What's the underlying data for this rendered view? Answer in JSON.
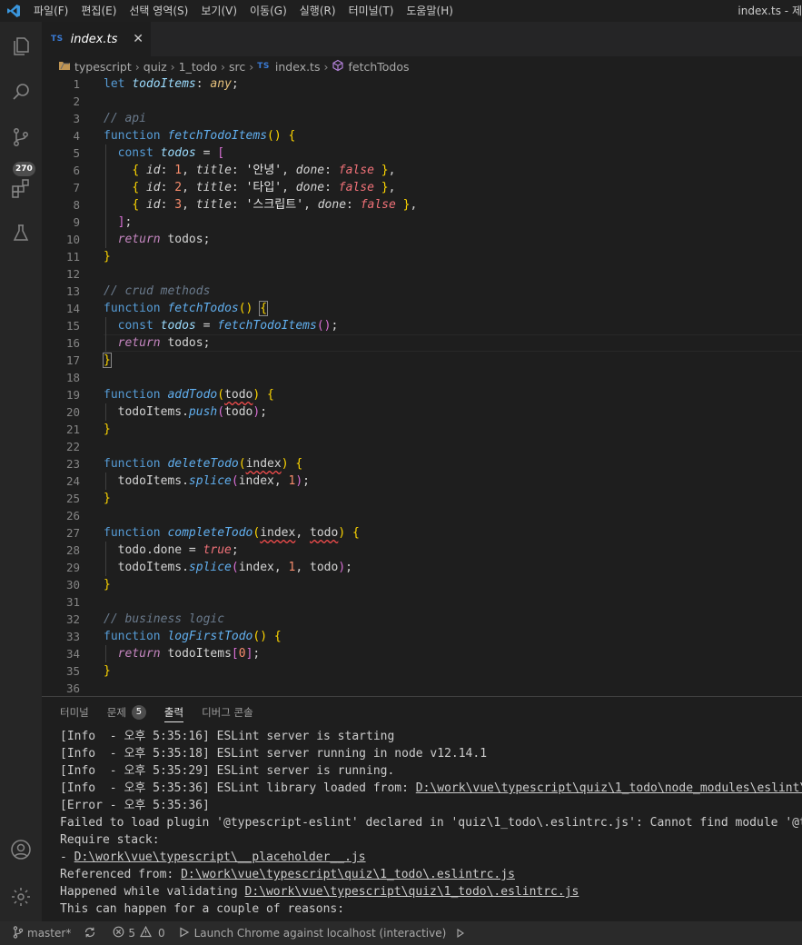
{
  "menu": [
    "파일(F)",
    "편집(E)",
    "선택 영역(S)",
    "보기(V)",
    "이동(G)",
    "실행(R)",
    "터미널(T)",
    "도움말(H)"
  ],
  "window_title": "index.ts - 제",
  "activity": {
    "scm_badge": "270"
  },
  "tab": {
    "badge": "TS",
    "label": "index.ts",
    "close": "✕"
  },
  "breadcrumb": {
    "items": [
      "typescript",
      "quiz",
      "1_todo",
      "src",
      "index.ts",
      "fetchTodos"
    ],
    "ts_badge": "TS"
  },
  "editor": {
    "current_line": 16,
    "lines": [
      {
        "n": "1",
        "t": [
          [
            "kw",
            "let"
          ],
          [
            "id",
            " "
          ],
          [
            "var",
            "todoItems"
          ],
          [
            "op",
            ":"
          ],
          [
            "id",
            " "
          ],
          [
            "type",
            "any"
          ],
          [
            "op",
            ";"
          ]
        ]
      },
      {
        "n": "2",
        "t": []
      },
      {
        "n": "3",
        "t": [
          [
            "cmt",
            "// api"
          ]
        ]
      },
      {
        "n": "4",
        "t": [
          [
            "kw",
            "function"
          ],
          [
            "id",
            " "
          ],
          [
            "fn",
            "fetchTodoItems"
          ],
          [
            "br1",
            "()"
          ],
          [
            "id",
            " "
          ],
          [
            "br1",
            "{"
          ]
        ]
      },
      {
        "n": "5",
        "t": [
          [
            "id",
            "  "
          ],
          [
            "kw",
            "const"
          ],
          [
            "id",
            " "
          ],
          [
            "var",
            "todos"
          ],
          [
            "id",
            " "
          ],
          [
            "op",
            "="
          ],
          [
            "id",
            " "
          ],
          [
            "br2",
            "["
          ]
        ]
      },
      {
        "n": "6",
        "t": [
          [
            "id",
            "    "
          ],
          [
            "br1",
            "{"
          ],
          [
            "id",
            " "
          ],
          [
            "prop",
            "id"
          ],
          [
            "op",
            ":"
          ],
          [
            "id",
            " "
          ],
          [
            "num",
            "1"
          ],
          [
            "op",
            ","
          ],
          [
            "id",
            " "
          ],
          [
            "prop",
            "title"
          ],
          [
            "op",
            ":"
          ],
          [
            "id",
            " "
          ],
          [
            "str",
            "'안녕'"
          ],
          [
            "op",
            ","
          ],
          [
            "id",
            " "
          ],
          [
            "prop",
            "done"
          ],
          [
            "op",
            ":"
          ],
          [
            "id",
            " "
          ],
          [
            "bool",
            "false"
          ],
          [
            "id",
            " "
          ],
          [
            "br1",
            "}"
          ],
          [
            "op",
            ","
          ]
        ]
      },
      {
        "n": "7",
        "t": [
          [
            "id",
            "    "
          ],
          [
            "br1",
            "{"
          ],
          [
            "id",
            " "
          ],
          [
            "prop",
            "id"
          ],
          [
            "op",
            ":"
          ],
          [
            "id",
            " "
          ],
          [
            "num",
            "2"
          ],
          [
            "op",
            ","
          ],
          [
            "id",
            " "
          ],
          [
            "prop",
            "title"
          ],
          [
            "op",
            ":"
          ],
          [
            "id",
            " "
          ],
          [
            "str",
            "'타입'"
          ],
          [
            "op",
            ","
          ],
          [
            "id",
            " "
          ],
          [
            "prop",
            "done"
          ],
          [
            "op",
            ":"
          ],
          [
            "id",
            " "
          ],
          [
            "bool",
            "false"
          ],
          [
            "id",
            " "
          ],
          [
            "br1",
            "}"
          ],
          [
            "op",
            ","
          ]
        ]
      },
      {
        "n": "8",
        "t": [
          [
            "id",
            "    "
          ],
          [
            "br1",
            "{"
          ],
          [
            "id",
            " "
          ],
          [
            "prop",
            "id"
          ],
          [
            "op",
            ":"
          ],
          [
            "id",
            " "
          ],
          [
            "num",
            "3"
          ],
          [
            "op",
            ","
          ],
          [
            "id",
            " "
          ],
          [
            "prop",
            "title"
          ],
          [
            "op",
            ":"
          ],
          [
            "id",
            " "
          ],
          [
            "str",
            "'스크립트'"
          ],
          [
            "op",
            ","
          ],
          [
            "id",
            " "
          ],
          [
            "prop",
            "done"
          ],
          [
            "op",
            ":"
          ],
          [
            "id",
            " "
          ],
          [
            "bool",
            "false"
          ],
          [
            "id",
            " "
          ],
          [
            "br1",
            "}"
          ],
          [
            "op",
            ","
          ]
        ]
      },
      {
        "n": "9",
        "t": [
          [
            "id",
            "  "
          ],
          [
            "br2",
            "]"
          ],
          [
            "op",
            ";"
          ]
        ]
      },
      {
        "n": "10",
        "t": [
          [
            "id",
            "  "
          ],
          [
            "ctl",
            "return"
          ],
          [
            "id",
            " todos;"
          ]
        ]
      },
      {
        "n": "11",
        "t": [
          [
            "br1",
            "}"
          ]
        ]
      },
      {
        "n": "12",
        "t": []
      },
      {
        "n": "13",
        "t": [
          [
            "cmt",
            "// crud methods"
          ]
        ]
      },
      {
        "n": "14",
        "t": [
          [
            "kw",
            "function"
          ],
          [
            "id",
            " "
          ],
          [
            "fn",
            "fetchTodos"
          ],
          [
            "br1",
            "()"
          ],
          [
            "id",
            " "
          ],
          [
            "br1m",
            "{"
          ]
        ]
      },
      {
        "n": "15",
        "t": [
          [
            "id",
            "  "
          ],
          [
            "kw",
            "const"
          ],
          [
            "id",
            " "
          ],
          [
            "var",
            "todos"
          ],
          [
            "id",
            " "
          ],
          [
            "op",
            "="
          ],
          [
            "id",
            " "
          ],
          [
            "fn",
            "fetchTodoItems"
          ],
          [
            "br2",
            "()"
          ],
          [
            "op",
            ";"
          ]
        ]
      },
      {
        "n": "16",
        "t": [
          [
            "id",
            "  "
          ],
          [
            "ctl",
            "return"
          ],
          [
            "id",
            " todos;"
          ]
        ]
      },
      {
        "n": "17",
        "t": [
          [
            "br1m",
            "}"
          ]
        ]
      },
      {
        "n": "18",
        "t": []
      },
      {
        "n": "19",
        "t": [
          [
            "kw",
            "function"
          ],
          [
            "id",
            " "
          ],
          [
            "fn",
            "addTodo"
          ],
          [
            "br1",
            "("
          ],
          [
            "err",
            "todo"
          ],
          [
            "br1",
            ")"
          ],
          [
            "id",
            " "
          ],
          [
            "br1",
            "{"
          ]
        ]
      },
      {
        "n": "20",
        "t": [
          [
            "id",
            "  todoItems."
          ],
          [
            "fn",
            "push"
          ],
          [
            "br2",
            "("
          ],
          [
            "id",
            "todo"
          ],
          [
            "br2",
            ")"
          ],
          [
            "op",
            ";"
          ]
        ]
      },
      {
        "n": "21",
        "t": [
          [
            "br1",
            "}"
          ]
        ]
      },
      {
        "n": "22",
        "t": []
      },
      {
        "n": "23",
        "t": [
          [
            "kw",
            "function"
          ],
          [
            "id",
            " "
          ],
          [
            "fn",
            "deleteTodo"
          ],
          [
            "br1",
            "("
          ],
          [
            "err",
            "index"
          ],
          [
            "br1",
            ")"
          ],
          [
            "id",
            " "
          ],
          [
            "br1",
            "{"
          ]
        ]
      },
      {
        "n": "24",
        "t": [
          [
            "id",
            "  todoItems."
          ],
          [
            "fn",
            "splice"
          ],
          [
            "br2",
            "("
          ],
          [
            "id",
            "index, "
          ],
          [
            "num",
            "1"
          ],
          [
            "br2",
            ")"
          ],
          [
            "op",
            ";"
          ]
        ]
      },
      {
        "n": "25",
        "t": [
          [
            "br1",
            "}"
          ]
        ]
      },
      {
        "n": "26",
        "t": []
      },
      {
        "n": "27",
        "t": [
          [
            "kw",
            "function"
          ],
          [
            "id",
            " "
          ],
          [
            "fn",
            "completeTodo"
          ],
          [
            "br1",
            "("
          ],
          [
            "err",
            "index"
          ],
          [
            "id",
            ", "
          ],
          [
            "err",
            "todo"
          ],
          [
            "br1",
            ")"
          ],
          [
            "id",
            " "
          ],
          [
            "br1",
            "{"
          ]
        ]
      },
      {
        "n": "28",
        "t": [
          [
            "id",
            "  todo.done "
          ],
          [
            "op",
            "="
          ],
          [
            "id",
            " "
          ],
          [
            "bool2",
            "true"
          ],
          [
            "op",
            ";"
          ]
        ]
      },
      {
        "n": "29",
        "t": [
          [
            "id",
            "  todoItems."
          ],
          [
            "fn",
            "splice"
          ],
          [
            "br2",
            "("
          ],
          [
            "id",
            "index, "
          ],
          [
            "num",
            "1"
          ],
          [
            "id",
            ", todo"
          ],
          [
            "br2",
            ")"
          ],
          [
            "op",
            ";"
          ]
        ]
      },
      {
        "n": "30",
        "t": [
          [
            "br1",
            "}"
          ]
        ]
      },
      {
        "n": "31",
        "t": []
      },
      {
        "n": "32",
        "t": [
          [
            "cmt",
            "// business logic"
          ]
        ]
      },
      {
        "n": "33",
        "t": [
          [
            "kw",
            "function"
          ],
          [
            "id",
            " "
          ],
          [
            "fn",
            "logFirstTodo"
          ],
          [
            "br1",
            "()"
          ],
          [
            "id",
            " "
          ],
          [
            "br1",
            "{"
          ]
        ]
      },
      {
        "n": "34",
        "t": [
          [
            "id",
            "  "
          ],
          [
            "ctl",
            "return"
          ],
          [
            "id",
            " todoItems"
          ],
          [
            "br2",
            "["
          ],
          [
            "num",
            "0"
          ],
          [
            "br2",
            "]"
          ],
          [
            "op",
            ";"
          ]
        ]
      },
      {
        "n": "35",
        "t": [
          [
            "br1",
            "}"
          ]
        ]
      },
      {
        "n": "36",
        "t": []
      }
    ]
  },
  "panel": {
    "tabs": [
      {
        "label": "터미널",
        "active": false
      },
      {
        "label": "문제",
        "active": false,
        "badge": "5"
      },
      {
        "label": "출력",
        "active": true
      },
      {
        "label": "디버그 콘솔",
        "active": false
      }
    ],
    "output": [
      [
        [
          "t",
          "[Info  - 오후 5:35:16] ESLint server is starting"
        ]
      ],
      [
        [
          "t",
          "[Info  - 오후 5:35:18] ESLint server running in node v12.14.1"
        ]
      ],
      [
        [
          "t",
          "[Info  - 오후 5:35:29] ESLint server is running."
        ]
      ],
      [
        [
          "t",
          "[Info  - 오후 5:35:36] ESLint library loaded from: "
        ],
        [
          "u",
          "D:\\work\\vue\\typescript\\quiz\\1_todo\\node_modules\\eslint\\l"
        ]
      ],
      [
        [
          "t",
          "[Error - 오후 5:35:36] "
        ]
      ],
      [
        [
          "t",
          "Failed to load plugin '@typescript-eslint' declared in 'quiz\\1_todo\\.eslintrc.js': Cannot find module '@ty"
        ]
      ],
      [
        [
          "t",
          "Require stack:"
        ]
      ],
      [
        [
          "t",
          "- "
        ],
        [
          "u",
          "D:\\work\\vue\\typescript\\__placeholder__.js"
        ]
      ],
      [
        [
          "t",
          "Referenced from: "
        ],
        [
          "u",
          "D:\\work\\vue\\typescript\\quiz\\1_todo\\.eslintrc.js"
        ]
      ],
      [
        [
          "t",
          "Happened while validating "
        ],
        [
          "u",
          "D:\\work\\vue\\typescript\\quiz\\1_todo\\.eslintrc.js"
        ]
      ],
      [
        [
          "t",
          "This can happen for a couple of reasons:"
        ]
      ]
    ]
  },
  "status": {
    "branch": "master*",
    "errors": "5",
    "warnings": "0",
    "launch": "Launch Chrome against localhost (interactive)"
  },
  "colors": {
    "accent": "#0078d4",
    "error": "#f14c4c",
    "ts": "#3a7bd5"
  }
}
